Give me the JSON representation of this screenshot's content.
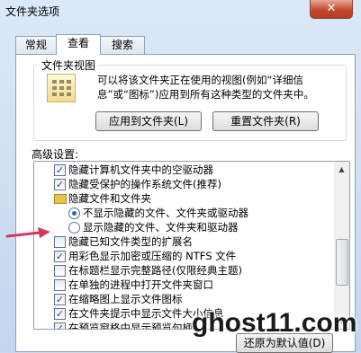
{
  "window": {
    "title": "文件夹选项",
    "close_glyph": "✕"
  },
  "tabs": [
    {
      "label": "常规"
    },
    {
      "label": "查看"
    },
    {
      "label": "搜索"
    }
  ],
  "folder_views": {
    "group_label": "文件夹视图",
    "description": "可以将该文件夹正在使用的视图(例如“详细信息”或“图标”)应用到所有这种类型的文件夹中。",
    "apply_button": "应用到文件夹(L)",
    "reset_button": "重置文件夹(R)"
  },
  "advanced": {
    "label": "高级设置:",
    "items": [
      {
        "kind": "checkbox",
        "checked": true,
        "label": "隐藏计算机文件夹中的空驱动器"
      },
      {
        "kind": "checkbox",
        "checked": true,
        "label": "隐藏受保护的操作系统文件(推荐)"
      },
      {
        "kind": "folder",
        "label": "隐藏文件和文件夹"
      },
      {
        "kind": "radio",
        "checked": true,
        "label": "不显示隐藏的文件、文件夹或驱动器"
      },
      {
        "kind": "radio",
        "checked": false,
        "label": "显示隐藏的文件、文件夹和驱动器"
      },
      {
        "kind": "checkbox",
        "checked": false,
        "label": "隐藏已知文件类型的扩展名"
      },
      {
        "kind": "checkbox",
        "checked": true,
        "label": "用彩色显示加密或压缩的 NTFS 文件"
      },
      {
        "kind": "checkbox",
        "checked": false,
        "label": "在标题栏显示完整路径(仅限经典主题)"
      },
      {
        "kind": "checkbox",
        "checked": false,
        "label": "在单独的进程中打开文件夹窗口"
      },
      {
        "kind": "checkbox",
        "checked": true,
        "label": "在缩略图上显示文件图标"
      },
      {
        "kind": "checkbox",
        "checked": true,
        "label": "在文件夹提示中显示文件大小信息"
      },
      {
        "kind": "checkbox",
        "checked": true,
        "label": "在预览窗格中显示预览句柄"
      }
    ],
    "restore_button": "还原为默认值(D)"
  },
  "watermark": "ghost11.com",
  "colors": {
    "arrow": "#d8345f",
    "close": "#c44a2f"
  }
}
